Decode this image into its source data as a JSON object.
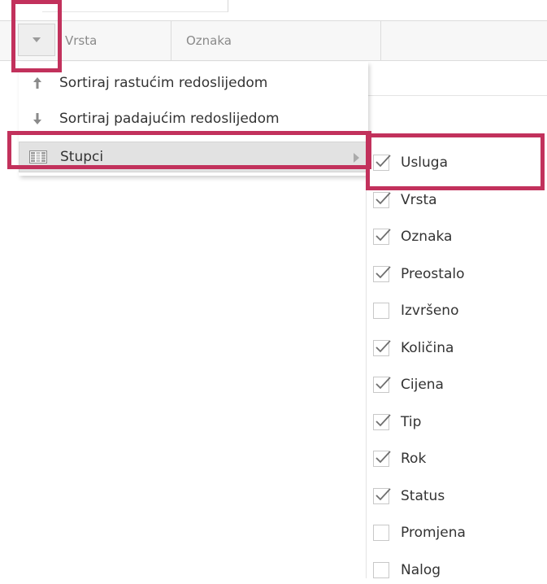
{
  "grid": {
    "columns": [
      "Vrsta",
      "Oznaka"
    ]
  },
  "column_menu": {
    "sort_asc": "Sortiraj rastućim redoslijedom",
    "sort_desc": "Sortiraj padajućim redoslijedom",
    "columns_label": "Stupci"
  },
  "columns_submenu": {
    "items": [
      {
        "label": "Usluga",
        "checked": true
      },
      {
        "label": "Vrsta",
        "checked": true
      },
      {
        "label": "Oznaka",
        "checked": true
      },
      {
        "label": "Preostalo",
        "checked": true
      },
      {
        "label": "Izvršeno",
        "checked": false
      },
      {
        "label": "Količina",
        "checked": true
      },
      {
        "label": "Cijena",
        "checked": true
      },
      {
        "label": "Tip",
        "checked": true
      },
      {
        "label": "Rok",
        "checked": true
      },
      {
        "label": "Status",
        "checked": true
      },
      {
        "label": "Promjena",
        "checked": false
      },
      {
        "label": "Nalog",
        "checked": false
      }
    ]
  },
  "colors": {
    "highlight": "#c2315c",
    "menu_hover": "#e2e2e2",
    "header_bg": "#f7f7f7"
  },
  "icons": {
    "header_menu": "caret-down-icon",
    "sort_asc": "arrow-up-icon",
    "sort_desc": "arrow-down-icon",
    "columns": "columns-grid-icon",
    "submenu": "chevron-right-icon",
    "checked": "checkmark-icon"
  }
}
